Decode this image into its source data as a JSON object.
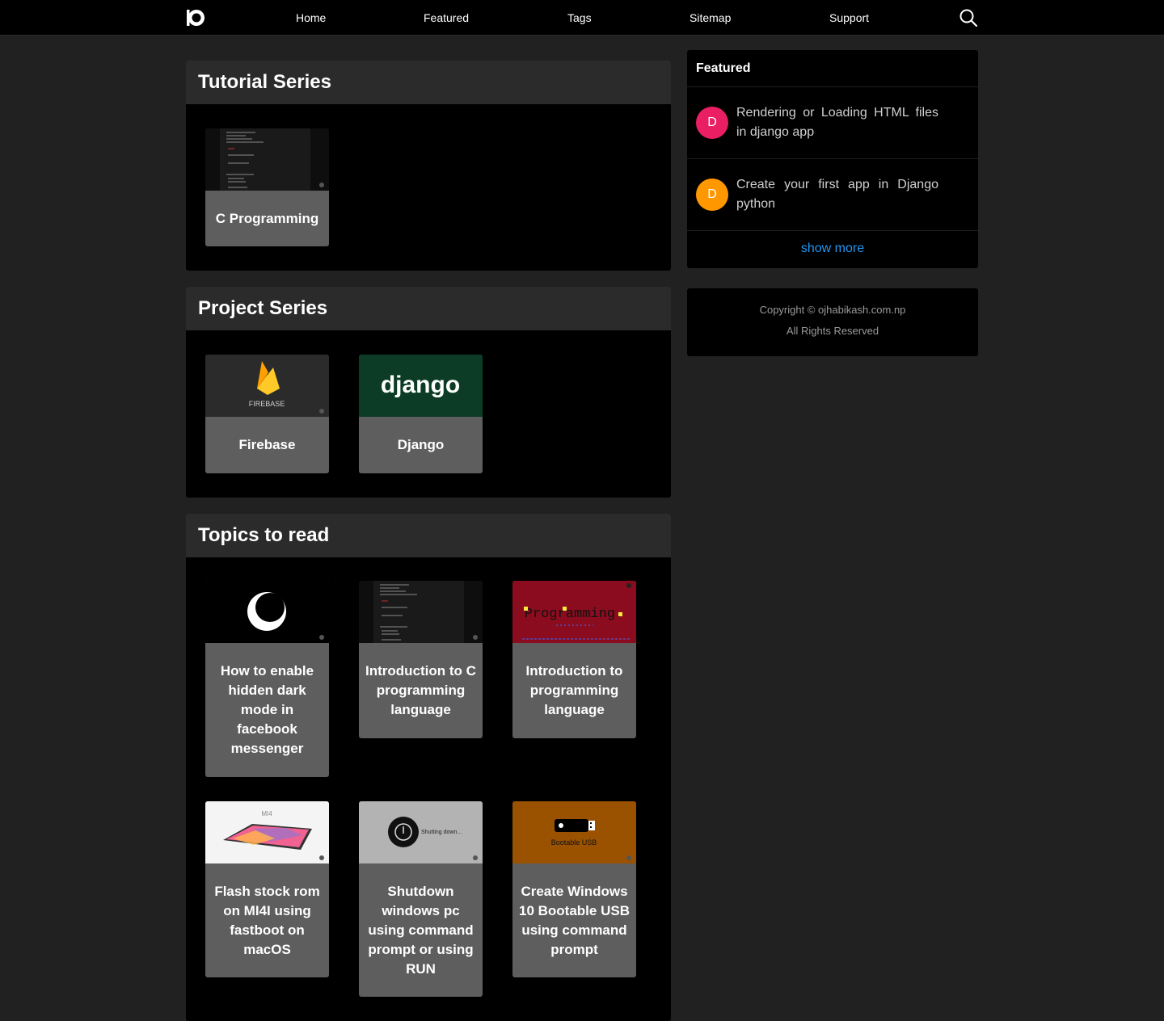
{
  "nav": {
    "links": [
      "Home",
      "Featured",
      "Tags",
      "Sitemap",
      "Support"
    ]
  },
  "tutorial_series": {
    "title": "Tutorial Series",
    "cards": [
      {
        "title": "C Programming",
        "thumb": "code-screenshot"
      }
    ]
  },
  "project_series": {
    "title": "Project Series",
    "cards": [
      {
        "title": "Firebase",
        "thumb": "firebase-logo",
        "thumb_text": "FIREBASE"
      },
      {
        "title": "Django",
        "thumb": "django-logo",
        "thumb_text": "django"
      }
    ]
  },
  "topics": {
    "title": "Topics to read",
    "cards": [
      {
        "title": "How to enable hidden dark mode in facebook messenger",
        "thumb": "crescent-moon"
      },
      {
        "title": "Introduction to C programming language",
        "thumb": "code-screenshot"
      },
      {
        "title": "Introduction to programming language",
        "thumb": "programming-banner",
        "thumb_text": "Programming."
      },
      {
        "title": "Flash stock rom on MI4I using fastboot on macOS",
        "thumb": "tablet",
        "thumb_text": "MI4"
      },
      {
        "title": "Shutdown windows pc using command prompt or using RUN",
        "thumb": "power-icon",
        "thumb_text": "Shutting down..."
      },
      {
        "title": "Create Windows 10 Bootable USB using command prompt",
        "thumb": "usb-drive",
        "thumb_text": "Bootable USB"
      }
    ]
  },
  "featured": {
    "title": "Featured",
    "items": [
      {
        "avatar": "D",
        "avatar_color": "#e91e63",
        "text": "Rendering or Loading HTML files in django app"
      },
      {
        "avatar": "D",
        "avatar_color": "#ff9800",
        "text": "Create your first app in Django python"
      }
    ],
    "show_more": "show more"
  },
  "footer": {
    "copyright": "Copyright © ojhabikash.com.np",
    "rights": "All Rights Reserved"
  },
  "colors": {
    "page_bg": "#212121",
    "section_header": "#2b2b2b",
    "card_bg": "#5e5e5e",
    "link_blue": "#2196f3"
  }
}
